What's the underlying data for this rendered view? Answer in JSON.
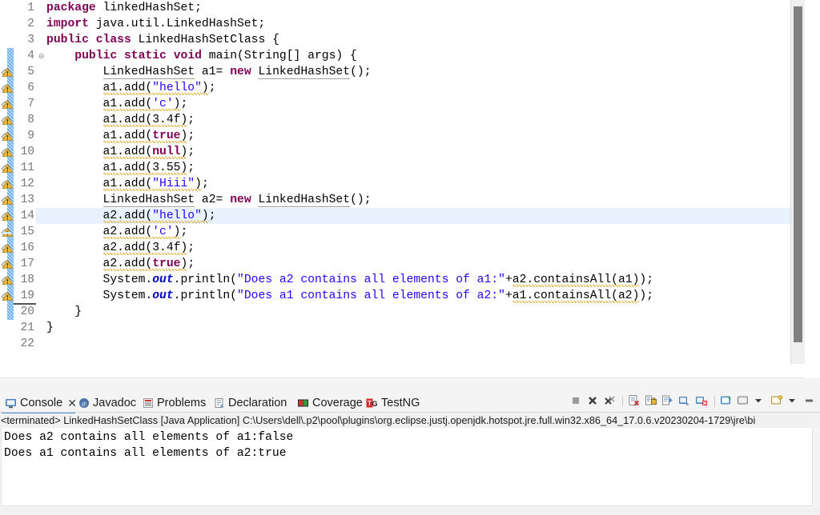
{
  "editor": {
    "name": "java-source-editor",
    "language": "java",
    "selected_line": 14,
    "first_visible_line": 1,
    "last_visible_line": 22,
    "colors": {
      "keyword": "#7f0055",
      "string": "#2a00ff",
      "field": "#0000c0",
      "text": "#000000",
      "line_number": "#787878",
      "current_line_highlight": "#e8f2fe",
      "change_bar": "#6aaee8",
      "warning_squiggle": "#e2a52b",
      "background": "#ffffff"
    },
    "lines": [
      {
        "n": "1",
        "fold": "",
        "warn": false,
        "changed": false,
        "tokens": [
          {
            "t": "package",
            "c": "kw"
          },
          {
            "t": " linkedHashSet;",
            "c": "plain"
          }
        ]
      },
      {
        "n": "2",
        "fold": "",
        "warn": false,
        "changed": false,
        "tokens": [
          {
            "t": "import",
            "c": "kw"
          },
          {
            "t": " java.util.LinkedHashSet;",
            "c": "plain"
          }
        ]
      },
      {
        "n": "3",
        "fold": "",
        "warn": false,
        "changed": false,
        "tokens": [
          {
            "t": "public",
            "c": "kw"
          },
          {
            "t": " ",
            "c": "plain"
          },
          {
            "t": "class",
            "c": "kw"
          },
          {
            "t": " LinkedHashSetClass {",
            "c": "plain"
          }
        ]
      },
      {
        "n": "4",
        "fold": "⊖",
        "warn": false,
        "changed": true,
        "tokens": [
          {
            "t": "    ",
            "c": "plain"
          },
          {
            "t": "public",
            "c": "kw"
          },
          {
            "t": " ",
            "c": "plain"
          },
          {
            "t": "static",
            "c": "kw"
          },
          {
            "t": " ",
            "c": "plain"
          },
          {
            "t": "void",
            "c": "kw"
          },
          {
            "t": " main(String[] args) {",
            "c": "plain"
          }
        ]
      },
      {
        "n": "5",
        "fold": "",
        "warn": true,
        "changed": true,
        "tokens": [
          {
            "t": "        ",
            "c": "plain"
          },
          {
            "t": "LinkedHashSet",
            "c": "plain under-solid"
          },
          {
            "t": " a1= ",
            "c": "plain"
          },
          {
            "t": "new",
            "c": "kw"
          },
          {
            "t": " ",
            "c": "plain"
          },
          {
            "t": "LinkedHashSet",
            "c": "plain under-solid"
          },
          {
            "t": "();",
            "c": "plain"
          }
        ]
      },
      {
        "n": "6",
        "fold": "",
        "warn": true,
        "changed": true,
        "tokens": [
          {
            "t": "        ",
            "c": "plain"
          },
          {
            "t": "a1.add(",
            "c": "plain under-warn"
          },
          {
            "t": "\"hello\"",
            "c": "str under-warn"
          },
          {
            "t": ")",
            "c": "plain under-warn"
          },
          {
            "t": ";",
            "c": "plain"
          }
        ]
      },
      {
        "n": "7",
        "fold": "",
        "warn": true,
        "changed": true,
        "tokens": [
          {
            "t": "        ",
            "c": "plain"
          },
          {
            "t": "a1.add(",
            "c": "plain under-warn"
          },
          {
            "t": "'c'",
            "c": "str under-warn"
          },
          {
            "t": ")",
            "c": "plain under-warn"
          },
          {
            "t": ";",
            "c": "plain"
          }
        ]
      },
      {
        "n": "8",
        "fold": "",
        "warn": true,
        "changed": true,
        "tokens": [
          {
            "t": "        ",
            "c": "plain"
          },
          {
            "t": "a1.add(3.4f)",
            "c": "plain under-warn"
          },
          {
            "t": ";",
            "c": "plain"
          }
        ]
      },
      {
        "n": "9",
        "fold": "",
        "warn": true,
        "changed": true,
        "tokens": [
          {
            "t": "        ",
            "c": "plain"
          },
          {
            "t": "a1.add(",
            "c": "plain under-warn"
          },
          {
            "t": "true",
            "c": "kw under-warn"
          },
          {
            "t": ")",
            "c": "plain under-warn"
          },
          {
            "t": ";",
            "c": "plain"
          }
        ]
      },
      {
        "n": "10",
        "fold": "",
        "warn": true,
        "changed": true,
        "tokens": [
          {
            "t": "        ",
            "c": "plain"
          },
          {
            "t": "a1.add(",
            "c": "plain under-warn"
          },
          {
            "t": "null",
            "c": "kw under-warn"
          },
          {
            "t": ")",
            "c": "plain under-warn"
          },
          {
            "t": ";",
            "c": "plain"
          }
        ]
      },
      {
        "n": "11",
        "fold": "",
        "warn": true,
        "changed": true,
        "tokens": [
          {
            "t": "        ",
            "c": "plain"
          },
          {
            "t": "a1.add(3.55)",
            "c": "plain under-warn"
          },
          {
            "t": ";",
            "c": "plain"
          }
        ]
      },
      {
        "n": "12",
        "fold": "",
        "warn": true,
        "changed": true,
        "tokens": [
          {
            "t": "        ",
            "c": "plain"
          },
          {
            "t": "a1.add(",
            "c": "plain under-warn"
          },
          {
            "t": "\"Hiii\"",
            "c": "str under-warn"
          },
          {
            "t": ")",
            "c": "plain under-warn"
          },
          {
            "t": ";",
            "c": "plain"
          }
        ]
      },
      {
        "n": "13",
        "fold": "",
        "warn": true,
        "changed": true,
        "tokens": [
          {
            "t": "        ",
            "c": "plain"
          },
          {
            "t": "LinkedHashSet",
            "c": "plain under-solid"
          },
          {
            "t": " a2= ",
            "c": "plain"
          },
          {
            "t": "new",
            "c": "kw"
          },
          {
            "t": " ",
            "c": "plain"
          },
          {
            "t": "LinkedHashSet",
            "c": "plain under-solid"
          },
          {
            "t": "();",
            "c": "plain"
          }
        ]
      },
      {
        "n": "14",
        "fold": "",
        "warn": true,
        "changed": true,
        "tokens": [
          {
            "t": "        ",
            "c": "plain"
          },
          {
            "t": "a2.add(",
            "c": "plain under-warn"
          },
          {
            "t": "\"hello\"",
            "c": "str under-warn"
          },
          {
            "t": ")",
            "c": "plain under-warn"
          },
          {
            "t": ";",
            "c": "plain"
          }
        ]
      },
      {
        "n": "15",
        "fold": "",
        "warn": true,
        "changed": true,
        "tokens": [
          {
            "t": "        ",
            "c": "plain"
          },
          {
            "t": "a2.add(",
            "c": "plain under-warn"
          },
          {
            "t": "'c'",
            "c": "str under-warn"
          },
          {
            "t": ")",
            "c": "plain under-warn"
          },
          {
            "t": ";",
            "c": "plain"
          }
        ]
      },
      {
        "n": "16",
        "fold": "",
        "warn": true,
        "changed": true,
        "tokens": [
          {
            "t": "        ",
            "c": "plain"
          },
          {
            "t": "a2.add(3.4f)",
            "c": "plain under-warn"
          },
          {
            "t": ";",
            "c": "plain"
          }
        ]
      },
      {
        "n": "17",
        "fold": "",
        "warn": true,
        "changed": true,
        "tokens": [
          {
            "t": "        ",
            "c": "plain"
          },
          {
            "t": "a2.add(",
            "c": "plain under-warn"
          },
          {
            "t": "true",
            "c": "kw under-warn"
          },
          {
            "t": ")",
            "c": "plain under-warn"
          },
          {
            "t": ";",
            "c": "plain"
          }
        ]
      },
      {
        "n": "18",
        "fold": "",
        "warn": true,
        "changed": true,
        "tokens": [
          {
            "t": "        System.",
            "c": "plain"
          },
          {
            "t": "out",
            "c": "fld"
          },
          {
            "t": ".println(",
            "c": "plain"
          },
          {
            "t": "\"Does a2 contains all elements of a1:\"",
            "c": "str"
          },
          {
            "t": "+",
            "c": "plain"
          },
          {
            "t": "a2.containsAll(a1)",
            "c": "plain under-warn"
          },
          {
            "t": ");",
            "c": "plain"
          }
        ]
      },
      {
        "n": "19",
        "fold": "",
        "warn": true,
        "changed": true,
        "tokens": [
          {
            "t": "        System.",
            "c": "plain"
          },
          {
            "t": "out",
            "c": "fld"
          },
          {
            "t": ".println(",
            "c": "plain"
          },
          {
            "t": "\"Does a1 contains all elements of a2:\"",
            "c": "str"
          },
          {
            "t": "+",
            "c": "plain"
          },
          {
            "t": "a1.containsAll(a2)",
            "c": "plain under-warn"
          },
          {
            "t": ");",
            "c": "plain"
          }
        ]
      },
      {
        "n": "20",
        "fold": "",
        "warn": false,
        "changed": true,
        "tokens": [
          {
            "t": "    }",
            "c": "plain"
          }
        ]
      },
      {
        "n": "21",
        "fold": "",
        "warn": false,
        "changed": false,
        "tokens": [
          {
            "t": "}",
            "c": "plain"
          }
        ]
      },
      {
        "n": "22",
        "fold": "",
        "warn": false,
        "changed": false,
        "tokens": [
          {
            "t": "",
            "c": "plain"
          }
        ]
      }
    ]
  },
  "console_panel": {
    "tabs": [
      {
        "label": "Console",
        "icon": "console-icon",
        "active": true,
        "closable": true
      },
      {
        "label": "Javadoc",
        "icon": "javadoc-icon",
        "active": false,
        "closable": false
      },
      {
        "label": "Problems",
        "icon": "problems-icon",
        "active": false,
        "closable": false
      },
      {
        "label": "Declaration",
        "icon": "declaration-icon",
        "active": false,
        "closable": false
      },
      {
        "label": "Coverage",
        "icon": "coverage-icon",
        "active": false,
        "closable": false
      },
      {
        "label": "TestNG",
        "icon": "testng-icon",
        "active": false,
        "closable": false
      }
    ],
    "toolbar": [
      {
        "name": "terminate-button",
        "icon": "stop-square-icon"
      },
      {
        "name": "remove-launch-button",
        "icon": "remove-x-icon"
      },
      {
        "name": "remove-all-launches-button",
        "icon": "remove-all-x-icon"
      },
      {
        "name": "separator-1",
        "icon": "separator"
      },
      {
        "name": "clear-console-button",
        "icon": "clear-console-icon"
      },
      {
        "name": "scroll-lock-button",
        "icon": "scroll-lock-icon"
      },
      {
        "name": "word-wrap-button",
        "icon": "word-wrap-icon"
      },
      {
        "name": "show-console-on-output-button",
        "icon": "show-on-output-icon"
      },
      {
        "name": "show-console-on-error-button",
        "icon": "show-on-error-icon"
      },
      {
        "name": "separator-2",
        "icon": "separator"
      },
      {
        "name": "pin-console-button",
        "icon": "pin-console-icon"
      },
      {
        "name": "display-selected-console-button",
        "icon": "display-console-icon"
      },
      {
        "name": "display-selected-console-menu",
        "icon": "chevron-down-icon"
      },
      {
        "name": "open-console-button",
        "icon": "open-console-icon"
      },
      {
        "name": "open-console-menu",
        "icon": "chevron-down-icon"
      },
      {
        "name": "minimize-button",
        "icon": "minimize-icon"
      }
    ],
    "terminated_status": "<terminated> LinkedHashSetClass [Java Application] C:\\Users\\dell\\.p2\\pool\\plugins\\org.eclipse.justj.openjdk.hotspot.jre.full.win32.x86_64_17.0.6.v20230204-1729\\jre\\bi",
    "output_lines": [
      "Does a2 contains all elements of a1:false",
      "Does a1 contains all elements of a2:true"
    ],
    "accent_color": "#4a90d9"
  },
  "scrollbars": {
    "editor_vertical": {
      "name": "editor-vertical-scrollbar",
      "thumb_visible": true
    },
    "editor_horizontal": {
      "name": "editor-horizontal-scrollbar",
      "left_arrow": "◀",
      "right_arrow": "▶"
    }
  }
}
